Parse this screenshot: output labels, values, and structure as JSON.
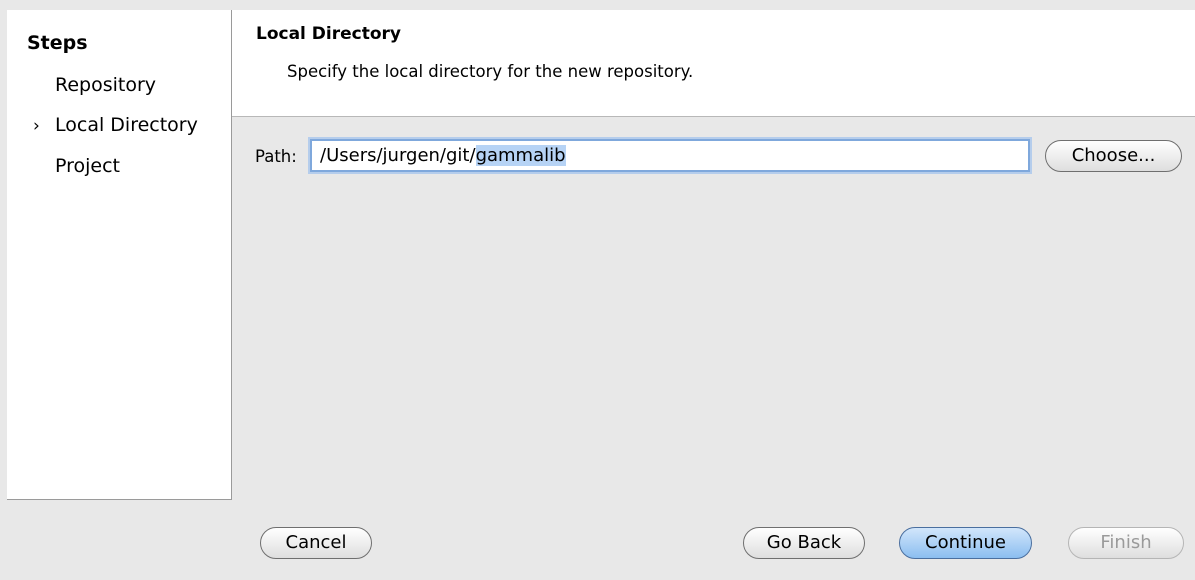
{
  "sidebar": {
    "title": "Steps",
    "steps": [
      {
        "label": "Repository",
        "marker": ""
      },
      {
        "label": "Local Directory",
        "marker": "›"
      },
      {
        "label": "Project",
        "marker": ""
      }
    ]
  },
  "header": {
    "title": "Local Directory",
    "description": "Specify the local directory for the new repository."
  },
  "path": {
    "label": "Path:",
    "value_prefix": "/Users/jurgen/git/",
    "value_selected": "gammalib"
  },
  "buttons": {
    "choose": "Choose...",
    "cancel": "Cancel",
    "go_back": "Go Back",
    "continue": "Continue",
    "finish": "Finish"
  }
}
